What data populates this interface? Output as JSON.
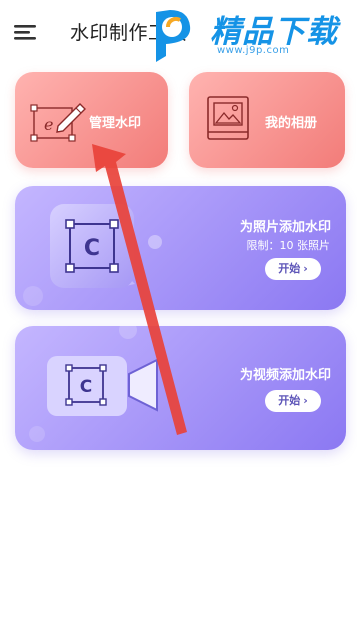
{
  "header": {
    "title": "水印制作工具",
    "menu_icon": "menu-icon"
  },
  "watermark": {
    "brand": "精品下载",
    "url": "www.j9p.com"
  },
  "cards": {
    "manage": {
      "label": "管理水印",
      "icon": "edit-watermark-icon"
    },
    "album": {
      "label": "我的相册",
      "icon": "photo-album-icon"
    },
    "photo": {
      "label": "为照片添加水印",
      "limit": "限制：10 张照片",
      "button": "开始",
      "icon": "photo-watermark-icon"
    },
    "video": {
      "label": "为视频添加水印",
      "button": "开始",
      "icon": "video-camera-icon"
    }
  },
  "colors": {
    "red_card": "#f27c79",
    "purple_card": "#8b78f2",
    "arrow": "#e8423a",
    "brand_blue": "#1593e6"
  }
}
